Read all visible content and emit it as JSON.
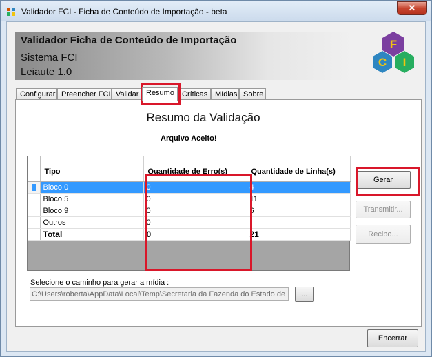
{
  "window": {
    "title": "Validador FCI - Ficha de Conteúdo de Importação - beta",
    "close_label": "✕"
  },
  "header": {
    "title": "Validador Ficha de Conteúdo de Importação",
    "subtitle": "Sistema FCI",
    "layout": "Leiaute 1.0"
  },
  "logo": {
    "letters": [
      "F",
      "C",
      "I"
    ],
    "colors": [
      "#7b3fa0",
      "#2e86c1",
      "#27ae60",
      "#f1c40f"
    ]
  },
  "tabs": [
    "Configurar",
    "Preencher FCI",
    "Validar",
    "Resumo",
    "Críticas",
    "Mídias",
    "Sobre"
  ],
  "active_tab": "Resumo",
  "summary": {
    "title": "Resumo da Validação",
    "status": "Arquivo Aceito!"
  },
  "grid": {
    "columns": [
      "Tipo",
      "Quantidade de Erro(s)",
      "Quantidade de Linha(s)"
    ],
    "rows": [
      {
        "tipo": "Bloco 0",
        "erros": "0",
        "linhas": "4",
        "selected": true
      },
      {
        "tipo": "Bloco 5",
        "erros": "0",
        "linhas": "11"
      },
      {
        "tipo": "Bloco 9",
        "erros": "0",
        "linhas": "6"
      },
      {
        "tipo": "Outros",
        "erros": "0",
        "linhas": ""
      },
      {
        "tipo": "Total",
        "erros": "0",
        "linhas": "21"
      }
    ]
  },
  "buttons": {
    "gerar": "Gerar",
    "transmitir": "Transmitir...",
    "recibo": "Recibo...",
    "browse": "...",
    "encerrar": "Encerrar"
  },
  "path": {
    "label": "Selecione o caminho para gerar a mídia :",
    "value": "C:\\Users\\roberta\\AppData\\Local\\Temp\\Secretaria da Fazenda do Estado de"
  },
  "colors": {
    "highlight": "#d9172a",
    "selection": "#3399ff"
  }
}
